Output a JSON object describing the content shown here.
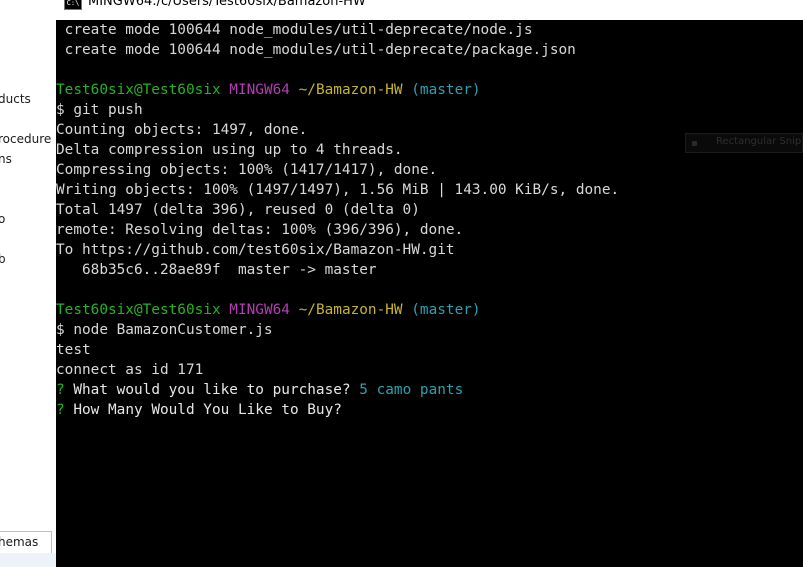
{
  "window": {
    "title": "MINGW64:/c/Users/Test60six/Bamazon-HW",
    "icon_label": "C:\\",
    "icon_name": "terminal-icon"
  },
  "background_app": {
    "items": [
      "ducts",
      "rocedure",
      "ns",
      "o",
      "b"
    ],
    "bottom_tab": "hemas"
  },
  "ghost_tooltip": {
    "label": "Rectangular Snip",
    "icon_name": "snip-icon"
  },
  "terminal": {
    "colors": {
      "background": "#000000",
      "text": "#d8d8d8",
      "user": "#22b522",
      "system": "#b43cb4",
      "path": "#c8b428",
      "branch": "#2aa1b3",
      "answer": "#2aa1b3"
    },
    "lines": [
      " create mode 100644 node_modules/util-deprecate/node.js",
      " create mode 100644 node_modules/util-deprecate/package.json",
      "",
      {
        "prompt": {
          "user": "Test60six@Test60six",
          "system": "MINGW64",
          "path": "~/Bamazon-HW",
          "branch": "(master)"
        }
      },
      "$ git push",
      "Counting objects: 1497, done.",
      "Delta compression using up to 4 threads.",
      "Compressing objects: 100% (1417/1417), done.",
      "Writing objects: 100% (1497/1497), 1.56 MiB | 143.00 KiB/s, done.",
      "Total 1497 (delta 396), reused 0 (delta 0)",
      "remote: Resolving deltas: 100% (396/396), done.",
      "To https://github.com/test60six/Bamazon-HW.git",
      "   68b35c6..28ae89f  master -> master",
      "",
      {
        "prompt": {
          "user": "Test60six@Test60six",
          "system": "MINGW64",
          "path": "~/Bamazon-HW",
          "branch": "(master)"
        }
      },
      "$ node BamazonCustomer.js",
      "test",
      "connect as id 171",
      {
        "question": {
          "mark": "?",
          "text": "What would you like to purchase?",
          "answer": "5 camo pants"
        }
      },
      {
        "question": {
          "mark": "?",
          "text": "How Many Would You Like to Buy?",
          "answer": ""
        }
      }
    ]
  }
}
